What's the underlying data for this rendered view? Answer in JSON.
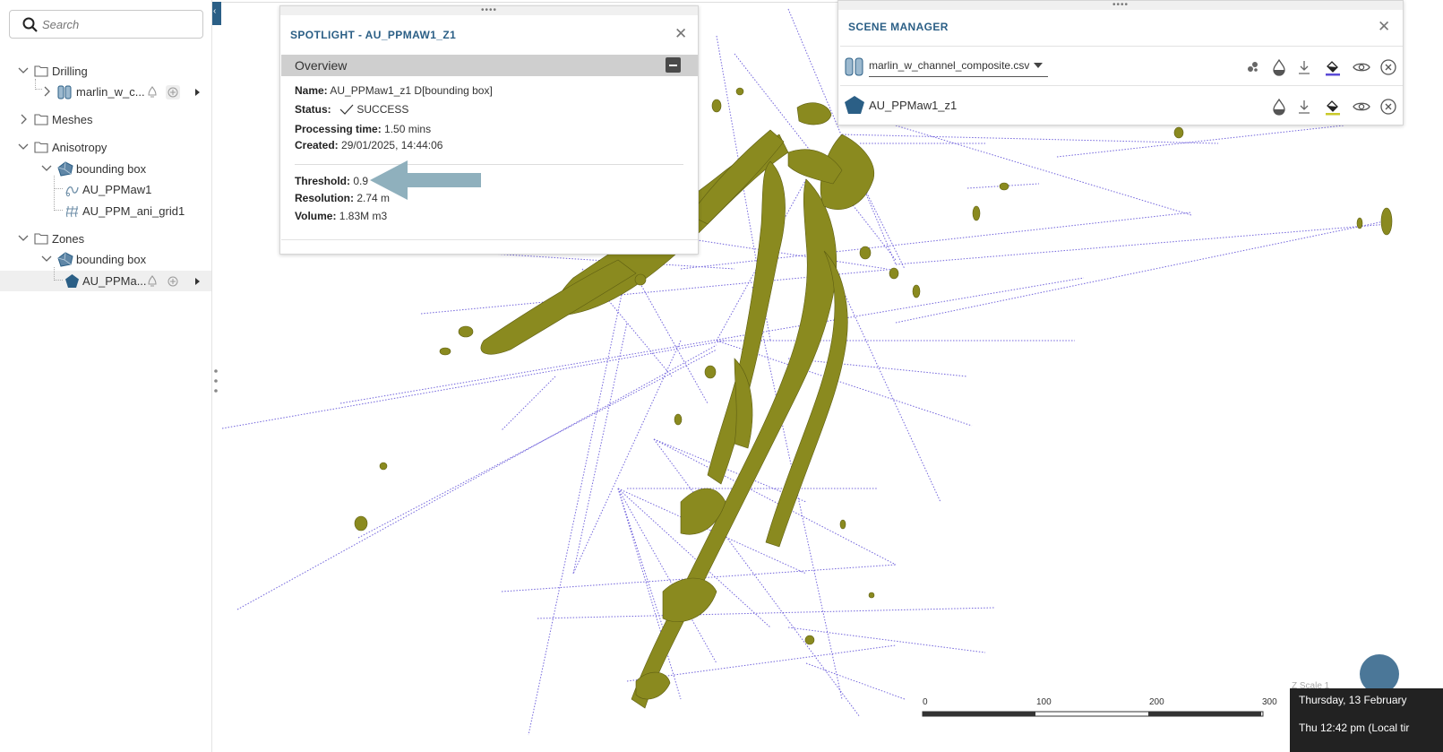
{
  "search": {
    "placeholder": "Search"
  },
  "tree": {
    "drilling": {
      "label": "Drilling",
      "child": "marlin_w_c..."
    },
    "meshes": {
      "label": "Meshes"
    },
    "anisotropy": {
      "label": "Anisotropy",
      "bbox": "bounding box",
      "items": [
        "AU_PPMaw1",
        "AU_PPM_ani_grid1"
      ]
    },
    "zones": {
      "label": "Zones",
      "bbox": "bounding box",
      "child": "AU_PPMa..."
    }
  },
  "spotlight": {
    "title": "SPOTLIGHT - AU_PPMAW1_Z1",
    "section": "Overview",
    "props": {
      "name_key": "Name:",
      "name_val": "AU_PPMaw1_z1 D[bounding box]",
      "status_key": "Status:",
      "status_val": "SUCCESS",
      "ptime_key": "Processing time:",
      "ptime_val": "1.50 mins",
      "created_key": "Created:",
      "created_val": "29/01/2025, 14:44:06",
      "threshold_key": "Threshold:",
      "threshold_val": "0.9",
      "res_key": "Resolution:",
      "res_val": "2.74 m",
      "vol_key": "Volume:",
      "vol_val": "1.83M m3"
    }
  },
  "scene_manager": {
    "title": "SCENE MANAGER",
    "rows": [
      {
        "name": "marlin_w_channel_composite.csv",
        "icon": "drillhole-icon"
      },
      {
        "name": "AU_PPMaw1_z1",
        "icon": "pentagon-icon"
      }
    ]
  },
  "scalebar": {
    "ticks": [
      "0",
      "100",
      "200",
      "300"
    ]
  },
  "viewport": {
    "zscale": "Z Scale 1"
  },
  "tooltip": {
    "date": "Thursday, 13 February",
    "time": "Thu 12:42 pm (Local tir"
  },
  "colors": {
    "accent": "#2b5f86",
    "mesh": "#8a8a1f",
    "drill": "#5b4bd6",
    "arrow": "#8fb0bd"
  }
}
